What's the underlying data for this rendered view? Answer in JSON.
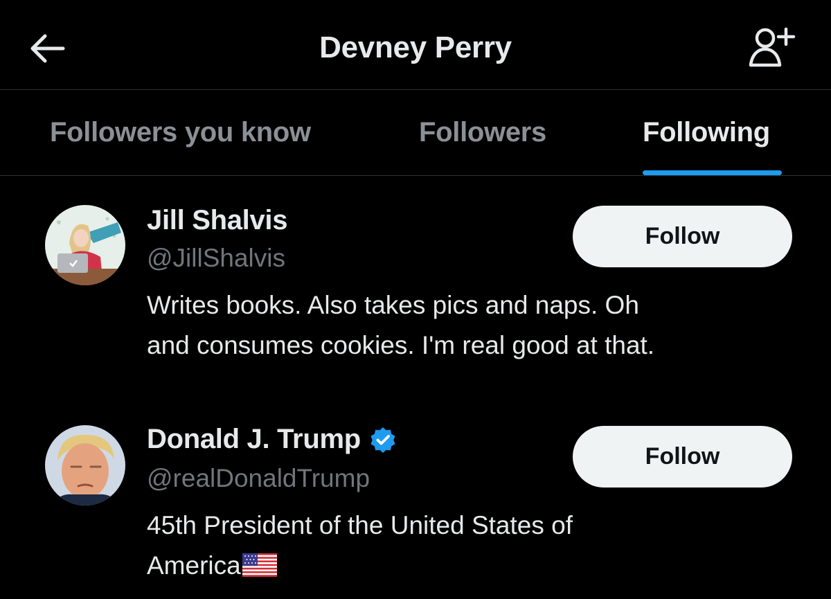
{
  "header": {
    "title": "Devney Perry",
    "back_icon": "arrow-left-icon",
    "add_user_icon": "person-add-icon"
  },
  "tabs": [
    {
      "label": "Followers you know",
      "active": false
    },
    {
      "label": "Followers",
      "active": false
    },
    {
      "label": "Following",
      "active": true
    }
  ],
  "users": [
    {
      "name": "Jill Shalvis",
      "handle": "@JillShalvis",
      "verified": false,
      "bio_lines": [
        "Writes books. Also takes pics and naps. Oh",
        "and consumes cookies. I'm real good at that."
      ],
      "follow_label": "Follow"
    },
    {
      "name": "Donald J. Trump",
      "handle": "@realDonaldTrump",
      "verified": true,
      "bio_lines": [
        "45th President of the United States of",
        "America"
      ],
      "bio_emoji": "us-flag-icon",
      "follow_label": "Follow"
    }
  ],
  "colors": {
    "background": "#000000",
    "accent": "#1d9bf0",
    "text_primary": "#e7e9ea",
    "text_secondary": "#71767b",
    "button_bg": "#eff3f4"
  }
}
